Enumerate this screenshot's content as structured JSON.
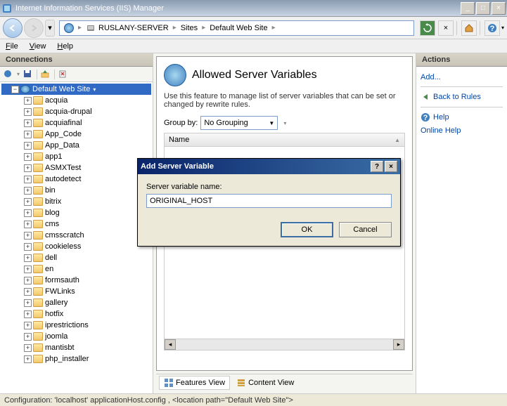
{
  "window": {
    "title": "Internet Information Services (IIS) Manager"
  },
  "breadcrumb": {
    "server": "RUSLANY-SERVER",
    "sites": "Sites",
    "site": "Default Web Site"
  },
  "menu": {
    "file": "File",
    "view": "View",
    "help": "Help"
  },
  "connections": {
    "header": "Connections",
    "root": "Default Web Site",
    "items": [
      "acquia",
      "acquia-drupal",
      "acquiafinal",
      "App_Code",
      "App_Data",
      "app1",
      "ASMXTest",
      "autodetect",
      "bin",
      "bitrix",
      "blog",
      "cms",
      "cmsscratch",
      "cookieless",
      "dell",
      "en",
      "formsauth",
      "FWLinks",
      "gallery",
      "hotfix",
      "iprestrictions",
      "joomla",
      "mantisbt",
      "php_installer"
    ]
  },
  "main": {
    "title": "Allowed Server Variables",
    "desc": "Use this feature to manage list of server variables that can be set or changed by rewrite rules.",
    "groupby_label": "Group by:",
    "groupby_value": "No Grouping",
    "col_name": "Name"
  },
  "tabs": {
    "features": "Features View",
    "content": "Content View"
  },
  "actions": {
    "header": "Actions",
    "add": "Add...",
    "back": "Back to Rules",
    "help": "Help",
    "online": "Online Help"
  },
  "dialog": {
    "title": "Add Server Variable",
    "label": "Server variable name:",
    "value": "ORIGINAL_HOST",
    "ok": "OK",
    "cancel": "Cancel"
  },
  "status": {
    "text": "Configuration: 'localhost' applicationHost.config , <location path=\"Default Web Site\">"
  }
}
